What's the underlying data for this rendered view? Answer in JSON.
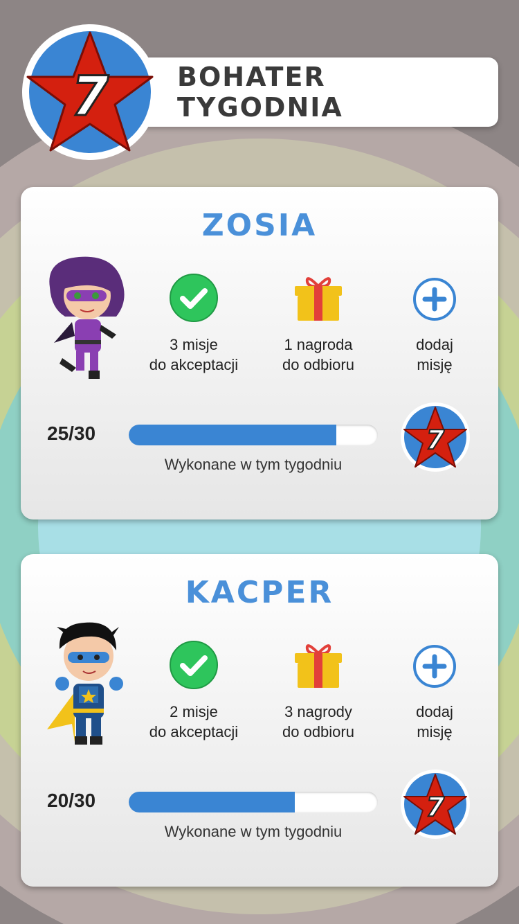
{
  "header": {
    "title": "Bohater tygodnia",
    "badge_number": "7"
  },
  "colors": {
    "accent_blue": "#4a90d9",
    "progress_blue": "#3a85d3",
    "star_red": "#d4200f",
    "check_green": "#2ec55c",
    "gift_yellow": "#f2c21a",
    "gift_ribbon": "#e2403a"
  },
  "children": [
    {
      "name": "Zosia",
      "stats": {
        "missions": "3 misje\ndo akceptacji",
        "rewards": "1 nagroda\ndo odbioru",
        "add": "dodaj\nmisję"
      },
      "score": "25/30",
      "progress": 0.833,
      "progress_caption": "Wykonane w tym tygodniu",
      "badge_number": "7"
    },
    {
      "name": "Kacper",
      "stats": {
        "missions": "2 misje\ndo akceptacji",
        "rewards": "3 nagrody\ndo odbioru",
        "add": "dodaj\nmisję"
      },
      "score": "20/30",
      "progress": 0.667,
      "progress_caption": "Wykonane w tym tygodniu",
      "badge_number": "7"
    }
  ]
}
